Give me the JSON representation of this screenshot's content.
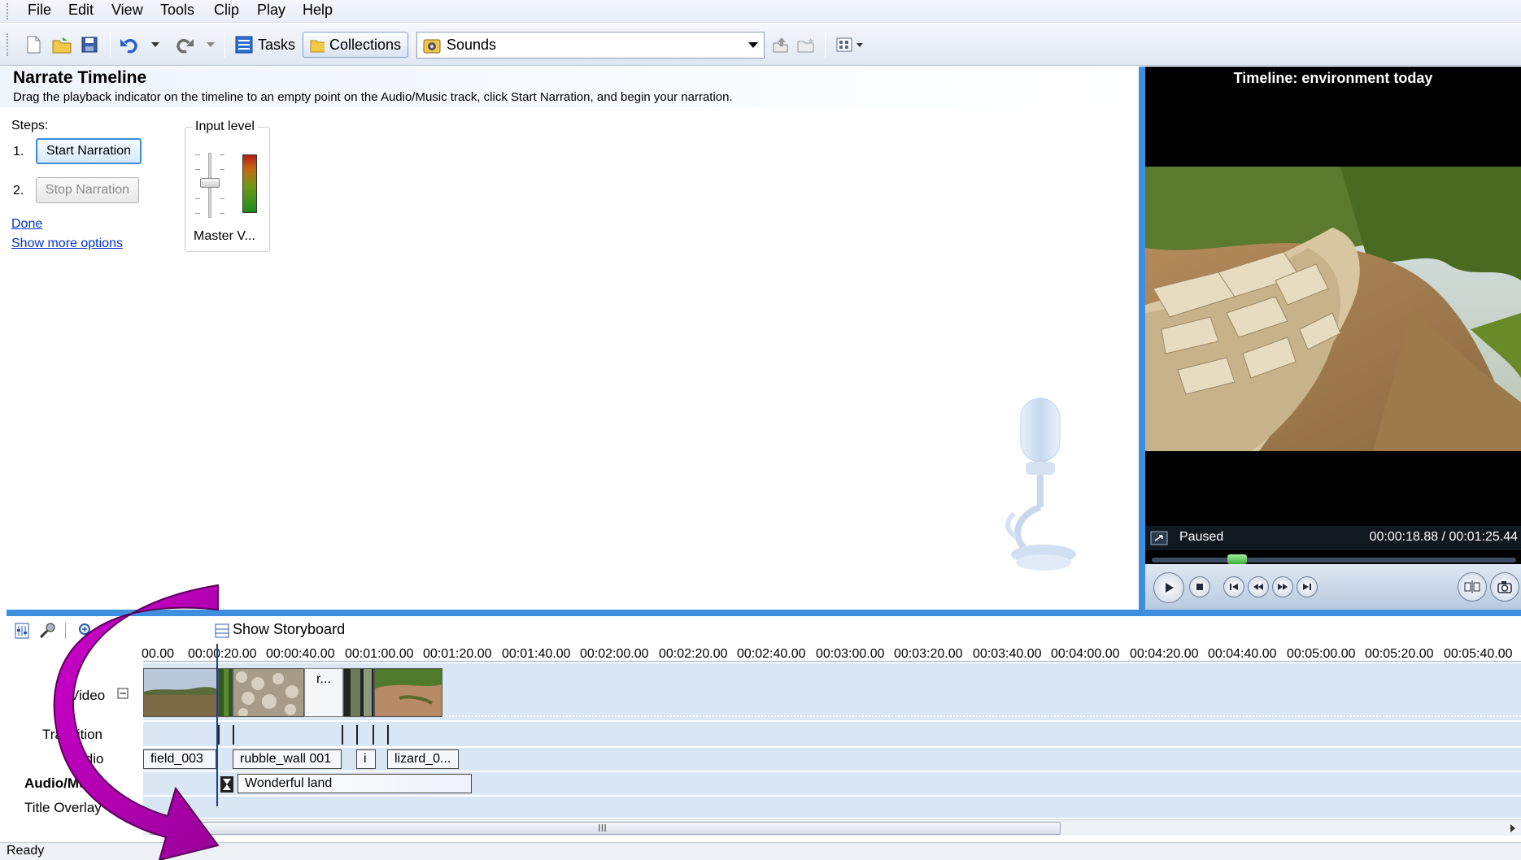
{
  "menu": [
    "File",
    "Edit",
    "View",
    "Tools",
    "Clip",
    "Play",
    "Help"
  ],
  "toolbar": {
    "tasks_label": "Tasks",
    "collections_label": "Collections",
    "collection_selected": "Sounds",
    "icons": [
      "new-project-icon",
      "open-project-icon",
      "save-project-icon",
      "undo-icon",
      "redo-icon",
      "tasks-icon",
      "collections-folder-icon",
      "sounds-collection-icon",
      "up-level-icon",
      "new-collection-folder-icon",
      "views-icon"
    ]
  },
  "task_pane": {
    "title": "Narrate Timeline",
    "description": "Drag the playback indicator on the timeline to an empty point on the Audio/Music track, click Start Narration, and begin your narration.",
    "steps_label": "Steps:",
    "step1_num": "1.",
    "step2_num": "2.",
    "start_label": "Start Narration",
    "stop_label": "Stop Narration",
    "done_link": "Done",
    "more_options_link": "Show more options",
    "input_level_label": "Input level",
    "master_volume_label": "Master V..."
  },
  "preview": {
    "title": "Timeline: environment today",
    "status": "Paused",
    "time": "00:00:18.88 / 00:01:25.44",
    "progress_fraction": 0.22
  },
  "timeline": {
    "storyboard_label": "Show Storyboard",
    "ruler_ticks": [
      "00.00",
      "00:00:20.00",
      "00:00:40.00",
      "00:01:00.00",
      "00:01:20.00",
      "00:01:40.00",
      "00:02:00.00",
      "00:02:20.00",
      "00:02:40.00",
      "00:03:00.00",
      "00:03:20.00",
      "00:03:40.00",
      "00:04:00.00",
      "00:04:20.00",
      "00:04:40.00",
      "00:05:00.00",
      "00:05:20.00",
      "00:05:40.00"
    ],
    "tracks": {
      "video": "Video",
      "transition": "Transition",
      "audio": "Audio",
      "audio_music": "Audio/Music",
      "title_overlay": "Title Overlay"
    },
    "video_clip_text": "r...",
    "audio_clips": [
      "field_003",
      "rubble_wall 001",
      "i",
      "lizard_0..."
    ],
    "music_clip": "Wonderful land",
    "scroll_grip": "III"
  },
  "status_bar": "Ready",
  "colors": {
    "accent_blue": "#3f8fe0",
    "overlay_arrow": "#b000b0"
  }
}
